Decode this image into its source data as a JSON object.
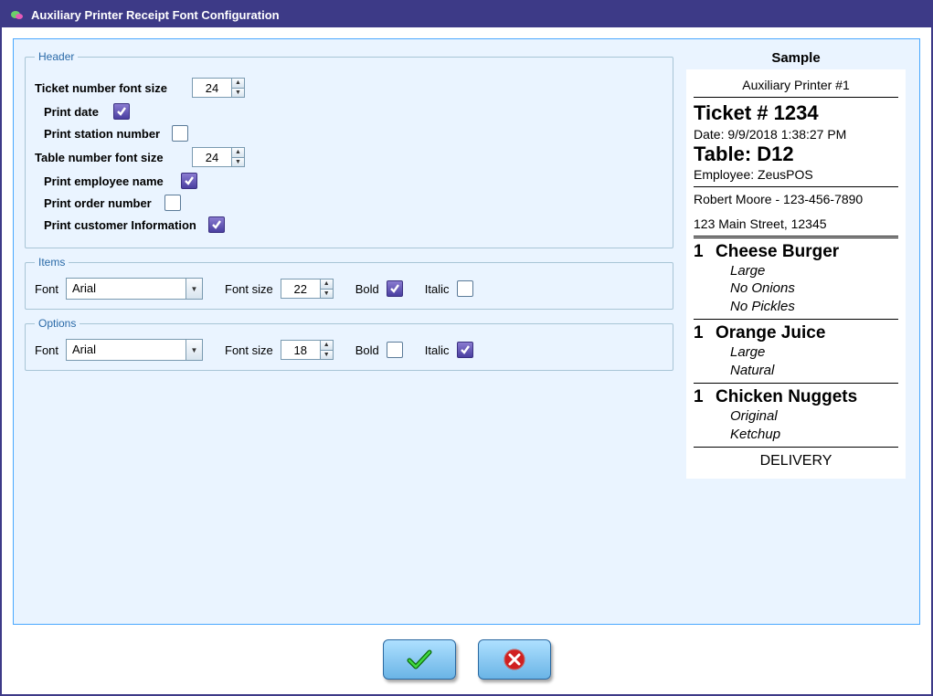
{
  "window": {
    "title": "Auxiliary Printer Receipt Font Configuration"
  },
  "fieldsets": {
    "header": "Header",
    "items": "Items",
    "options": "Options"
  },
  "labels": {
    "ticket_font_size": "Ticket number font size",
    "print_date": "Print date",
    "print_station": "Print station number",
    "table_font_size": "Table number font size",
    "print_employee": "Print employee name",
    "print_order": "Print order number",
    "print_customer": "Print customer Information",
    "font": "Font",
    "font_size": "Font size",
    "bold": "Bold",
    "italic": "Italic"
  },
  "values": {
    "ticket_font_size": "24",
    "table_font_size": "24",
    "print_date": true,
    "print_station": false,
    "print_employee": true,
    "print_order": false,
    "print_customer": true,
    "items_font": "Arial",
    "items_font_size": "22",
    "items_bold": true,
    "items_italic": false,
    "options_font": "Arial",
    "options_font_size": "18",
    "options_bold": false,
    "options_italic": true
  },
  "sample": {
    "heading": "Sample",
    "printer_name": "Auxiliary Printer #1",
    "ticket": "Ticket # 1234",
    "date": "Date: 9/9/2018 1:38:27 PM",
    "table": "Table: D12",
    "employee": "Employee: ZeusPOS",
    "customer_line1": "Robert Moore - 123-456-7890",
    "customer_line2": "123 Main Street, 12345",
    "items": [
      {
        "qty": "1",
        "name": "Cheese Burger",
        "opts": [
          "Large",
          "No Onions",
          "No Pickles"
        ]
      },
      {
        "qty": "1",
        "name": "Orange Juice",
        "opts": [
          "Large",
          "Natural"
        ]
      },
      {
        "qty": "1",
        "name": "Chicken Nuggets",
        "opts": [
          "Original",
          "Ketchup"
        ]
      }
    ],
    "footer": "DELIVERY"
  }
}
